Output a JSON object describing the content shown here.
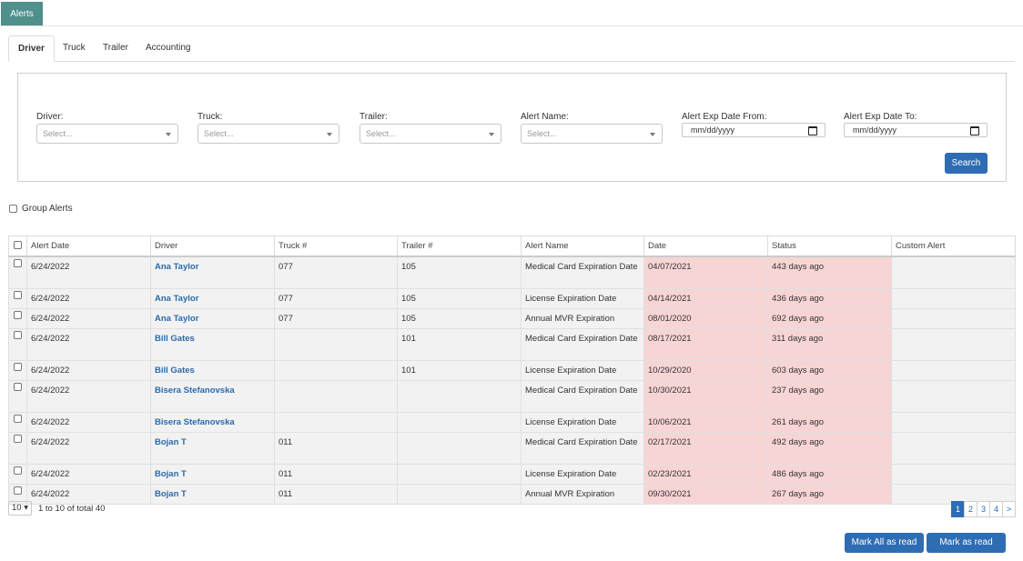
{
  "top_tab": {
    "label": "Alerts"
  },
  "subtabs": [
    "Driver",
    "Truck",
    "Trailer",
    "Accounting"
  ],
  "filters": {
    "driver": {
      "label": "Driver:",
      "placeholder": "Select..."
    },
    "truck": {
      "label": "Truck:",
      "placeholder": "Select..."
    },
    "trailer": {
      "label": "Trailer:",
      "placeholder": "Select..."
    },
    "alert_name": {
      "label": "Alert Name:",
      "placeholder": "Select..."
    },
    "exp_from": {
      "label": "Alert Exp Date From:",
      "placeholder": "mm/dd/yyyy"
    },
    "exp_to": {
      "label": "Alert Exp Date To:",
      "placeholder": "mm/dd/yyyy"
    },
    "search_label": "Search"
  },
  "group_alerts_label": "Group Alerts",
  "table": {
    "headers": [
      "Alert Date",
      "Driver",
      "Truck #",
      "Trailer #",
      "Alert Name",
      "Date",
      "Status",
      "Custom Alert"
    ],
    "rows": [
      {
        "alert_date": "6/24/2022",
        "driver": "Ana Taylor",
        "truck": "077",
        "trailer": "105",
        "alert_name": "Medical Card Expiration Date",
        "date": "04/07/2021",
        "status": "443 days ago",
        "custom": ""
      },
      {
        "alert_date": "6/24/2022",
        "driver": "Ana Taylor",
        "truck": "077",
        "trailer": "105",
        "alert_name": "License Expiration Date",
        "date": "04/14/2021",
        "status": "436 days ago",
        "custom": ""
      },
      {
        "alert_date": "6/24/2022",
        "driver": "Ana Taylor",
        "truck": "077",
        "trailer": "105",
        "alert_name": "Annual MVR Expiration",
        "date": "08/01/2020",
        "status": "692 days ago",
        "custom": ""
      },
      {
        "alert_date": "6/24/2022",
        "driver": "Bill Gates",
        "truck": "",
        "trailer": "101",
        "alert_name": "Medical Card Expiration Date",
        "date": "08/17/2021",
        "status": "311 days ago",
        "custom": ""
      },
      {
        "alert_date": "6/24/2022",
        "driver": "Bill Gates",
        "truck": "",
        "trailer": "101",
        "alert_name": "License Expiration Date",
        "date": "10/29/2020",
        "status": "603 days ago",
        "custom": ""
      },
      {
        "alert_date": "6/24/2022",
        "driver": "Bisera Stefanovska",
        "truck": "",
        "trailer": "",
        "alert_name": "Medical Card Expiration Date",
        "date": "10/30/2021",
        "status": "237 days ago",
        "custom": ""
      },
      {
        "alert_date": "6/24/2022",
        "driver": "Bisera Stefanovska",
        "truck": "",
        "trailer": "",
        "alert_name": "License Expiration Date",
        "date": "10/06/2021",
        "status": "261 days ago",
        "custom": ""
      },
      {
        "alert_date": "6/24/2022",
        "driver": "Bojan T",
        "truck": "011",
        "trailer": "",
        "alert_name": "Medical Card Expiration Date",
        "date": "02/17/2021",
        "status": "492 days ago",
        "custom": ""
      },
      {
        "alert_date": "6/24/2022",
        "driver": "Bojan T",
        "truck": "011",
        "trailer": "",
        "alert_name": "License Expiration Date",
        "date": "02/23/2021",
        "status": "486 days ago",
        "custom": ""
      },
      {
        "alert_date": "6/24/2022",
        "driver": "Bojan T",
        "truck": "011",
        "trailer": "",
        "alert_name": "Annual MVR Expiration",
        "date": "09/30/2021",
        "status": "267 days ago",
        "custom": ""
      }
    ]
  },
  "pager": {
    "page_size": "10",
    "summary": "1 to 10 of total 40",
    "pages": [
      "1",
      "2",
      "3",
      "4"
    ],
    "next": ">"
  },
  "actions": {
    "mark_all": "Mark All as read",
    "mark": "Mark as read"
  },
  "colors": {
    "accent": "#2e6db3",
    "tab": "#4f8f8c",
    "overdue": "#f8d5d5"
  }
}
